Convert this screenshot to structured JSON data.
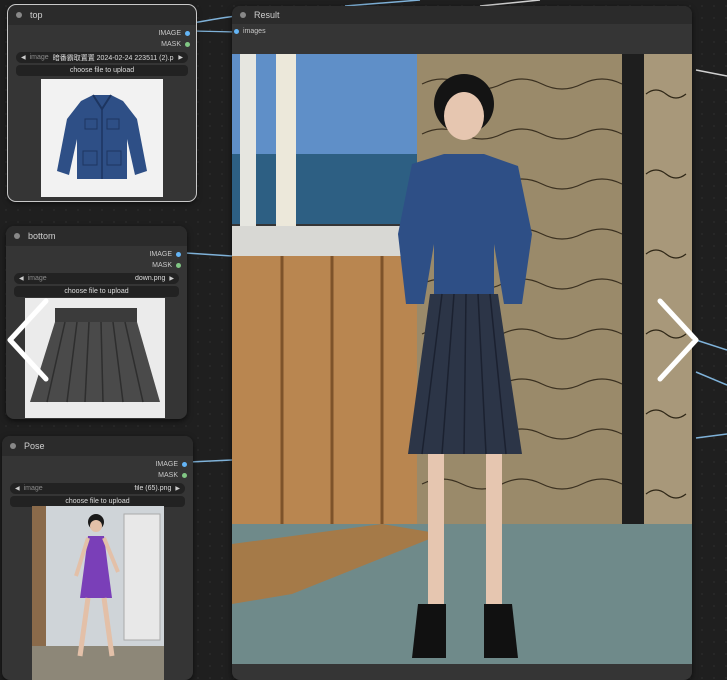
{
  "nodes": {
    "top": {
      "title": "top",
      "outputs": [
        "IMAGE",
        "MASK"
      ],
      "image_label": "image",
      "image_value": "暗番霸取置置 2024-02-24 223511 (2).png",
      "upload_label": "choose file to upload"
    },
    "bottom": {
      "title": "bottom",
      "outputs": [
        "IMAGE",
        "MASK"
      ],
      "image_label": "image",
      "image_value": "down.png",
      "upload_label": "choose file to upload"
    },
    "pose": {
      "title": "Pose",
      "outputs": [
        "IMAGE",
        "MASK"
      ],
      "image_label": "image",
      "image_value": "file (65).png",
      "upload_label": "choose file to upload"
    },
    "result": {
      "title": "Result",
      "input_label": "images"
    }
  },
  "colors": {
    "image_port": "#64b5f6",
    "mask_port": "#81c784",
    "wire": "#7fb2d9"
  },
  "icons": {
    "prev": "chevron-left-icon",
    "next": "chevron-right-icon"
  }
}
